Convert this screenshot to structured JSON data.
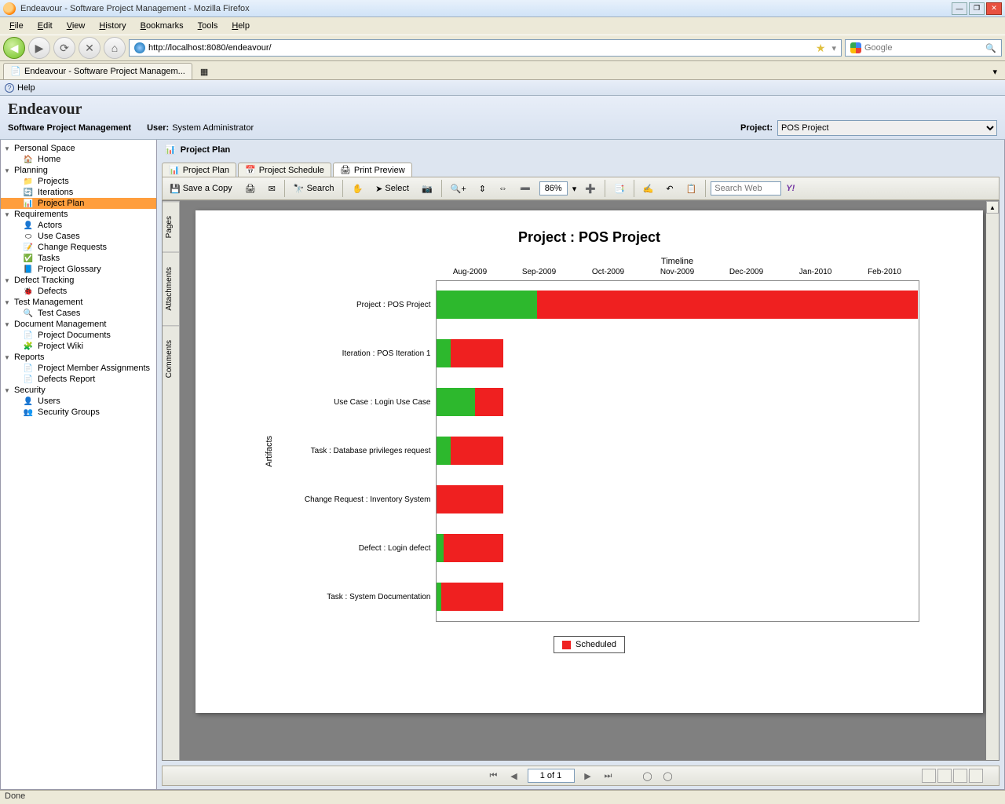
{
  "window": {
    "title": "Endeavour - Software Project Management - Mozilla Firefox"
  },
  "menubar": [
    "File",
    "Edit",
    "View",
    "History",
    "Bookmarks",
    "Tools",
    "Help"
  ],
  "url": "http://localhost:8080/endeavour/",
  "search_placeholder": "Google",
  "browser_tab": "Endeavour - Software Project Managem...",
  "helpbar": "Help",
  "app": {
    "brand": "Endeavour",
    "subtitle": "Software Project Management",
    "user_label": "User:",
    "user_value": "System Administrator",
    "project_label": "Project:",
    "project_value": "POS Project"
  },
  "sidebar": [
    {
      "cat": "Personal Space",
      "items": [
        {
          "icon": "🏠",
          "label": "Home"
        }
      ]
    },
    {
      "cat": "Planning",
      "items": [
        {
          "icon": "📁",
          "label": "Projects"
        },
        {
          "icon": "🔄",
          "label": "Iterations"
        },
        {
          "icon": "📊",
          "label": "Project Plan",
          "selected": true
        }
      ]
    },
    {
      "cat": "Requirements",
      "items": [
        {
          "icon": "👤",
          "label": "Actors"
        },
        {
          "icon": "⬭",
          "label": "Use Cases"
        },
        {
          "icon": "📝",
          "label": "Change Requests"
        },
        {
          "icon": "✅",
          "label": "Tasks"
        },
        {
          "icon": "📘",
          "label": "Project Glossary"
        }
      ]
    },
    {
      "cat": "Defect Tracking",
      "items": [
        {
          "icon": "🐞",
          "label": "Defects"
        }
      ]
    },
    {
      "cat": "Test Management",
      "items": [
        {
          "icon": "🔍",
          "label": "Test Cases"
        }
      ]
    },
    {
      "cat": "Document Management",
      "items": [
        {
          "icon": "📄",
          "label": "Project Documents"
        },
        {
          "icon": "🧩",
          "label": "Project Wiki"
        }
      ]
    },
    {
      "cat": "Reports",
      "items": [
        {
          "icon": "📄",
          "label": "Project Member Assignments"
        },
        {
          "icon": "📄",
          "label": "Defects Report"
        }
      ]
    },
    {
      "cat": "Security",
      "items": [
        {
          "icon": "👤",
          "label": "Users"
        },
        {
          "icon": "👥",
          "label": "Security Groups"
        }
      ]
    }
  ],
  "panel_title": "Project Plan",
  "subtabs": [
    {
      "label": "Project Plan",
      "icon": "📊"
    },
    {
      "label": "Project Schedule",
      "icon": "📅"
    },
    {
      "label": "Print Preview",
      "icon": "🖨",
      "active": true
    }
  ],
  "pdf_toolbar": {
    "save": "Save a Copy",
    "search": "Search",
    "select": "Select",
    "zoom": "86%",
    "websearch": "Search Web"
  },
  "side_tabs": [
    "Pages",
    "Attachments",
    "Comments"
  ],
  "page_indicator": "1 of 1",
  "status": "Done",
  "chart_data": {
    "type": "gantt",
    "title": "Project : POS Project",
    "xlabel": "Timeline",
    "ylabel": "Artifacts",
    "x_ticks": [
      "Aug-2009",
      "Sep-2009",
      "Oct-2009",
      "Nov-2009",
      "Dec-2009",
      "Jan-2010",
      "Feb-2010"
    ],
    "rows": [
      {
        "label": "Project : POS Project",
        "start": 0,
        "progress_end": 21,
        "end": 100
      },
      {
        "label": "Iteration : POS Iteration 1",
        "start": 0,
        "progress_end": 3,
        "end": 14
      },
      {
        "label": "Use Case : Login Use Case",
        "start": 0,
        "progress_end": 8,
        "end": 14
      },
      {
        "label": "Task : Database privileges request",
        "start": 0,
        "progress_end": 3,
        "end": 14
      },
      {
        "label": "Change Request : Inventory System",
        "start": 0,
        "progress_end": 0,
        "end": 14
      },
      {
        "label": "Defect : Login defect",
        "start": 0,
        "progress_end": 1.5,
        "end": 14
      },
      {
        "label": "Task : System Documentation",
        "start": 0,
        "progress_end": 1,
        "end": 14
      }
    ],
    "legend": [
      "Scheduled"
    ]
  }
}
